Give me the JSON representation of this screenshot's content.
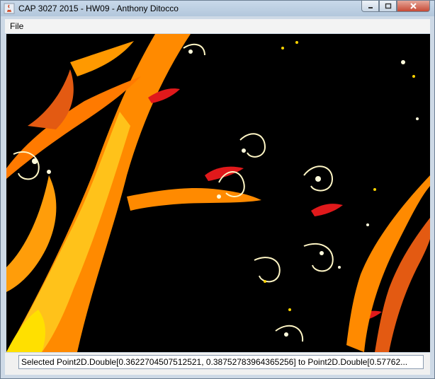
{
  "window": {
    "title": "CAP 3027 2015 - HW09 - Anthony Ditocco",
    "controls": {
      "minimize_icon": "minimize-icon",
      "maximize_icon": "maximize-icon",
      "close_icon": "close-icon"
    }
  },
  "menu": {
    "file_label": "File"
  },
  "status": {
    "text": "Selected Point2D.Double[0.3622704507512521, 0.38752783964365256] to Point2D.Double[0.57762..."
  },
  "colors": {
    "fractal_black": "#000000",
    "fractal_red": "#e0191b",
    "fractal_orange": "#ff8a00",
    "fractal_yellow": "#ffd400",
    "fractal_cream": "#fff6c5"
  }
}
